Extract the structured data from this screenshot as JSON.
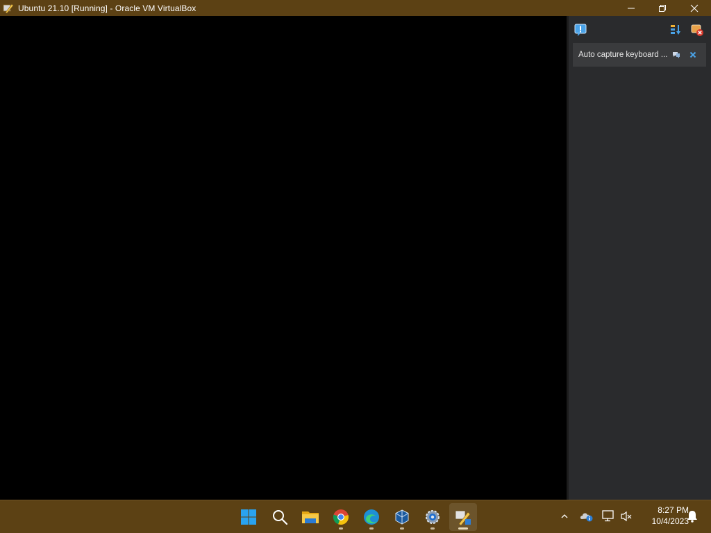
{
  "window": {
    "title": "Ubuntu 21.10 [Running] - Oracle VM VirtualBox"
  },
  "notification_panel": {
    "message": "Auto capture keyboard ..."
  },
  "taskbar": {
    "apps": [
      {
        "name": "Start",
        "icon": "windows-start-icon"
      },
      {
        "name": "Search",
        "icon": "search-icon"
      },
      {
        "name": "File Explorer",
        "icon": "folder-icon"
      },
      {
        "name": "Google Chrome",
        "icon": "chrome-icon"
      },
      {
        "name": "Microsoft Edge",
        "icon": "edge-icon"
      },
      {
        "name": "VirtualBox",
        "icon": "virtualbox-icon"
      },
      {
        "name": "Settings",
        "icon": "settings-gear-icon"
      },
      {
        "name": "Ubuntu VM",
        "icon": "vm-running-icon"
      }
    ],
    "clock": {
      "time": "8:27 PM",
      "date": "10/4/2023"
    }
  },
  "colors": {
    "titlebar": "#5c4114",
    "taskbar": "#5c4114",
    "panel": "#2a2b2d",
    "accent_blue": "#3b8ed6"
  }
}
